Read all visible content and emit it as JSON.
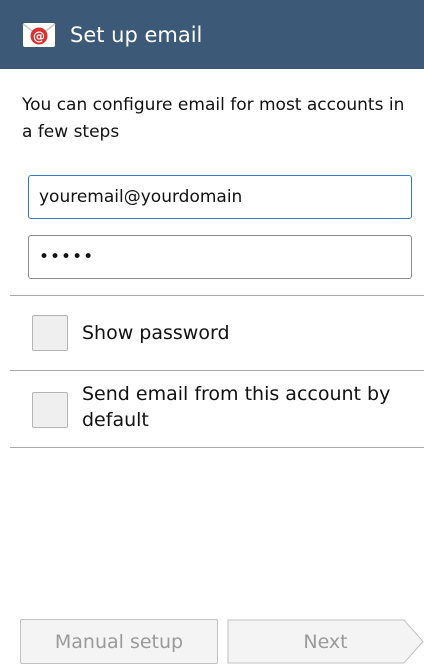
{
  "action_bar": {
    "title": "Set up email",
    "icon": "email-app-icon",
    "color": "#3c5a78"
  },
  "intro_text": "You can configure email for most accounts in a few steps",
  "form": {
    "email_value": "youremail@yourdomain",
    "password_value": "•••••"
  },
  "options": {
    "show_password_label": "Show password",
    "default_account_label": "Send email from this account by default"
  },
  "buttons": {
    "manual_setup_label": "Manual setup",
    "next_label": "Next"
  }
}
